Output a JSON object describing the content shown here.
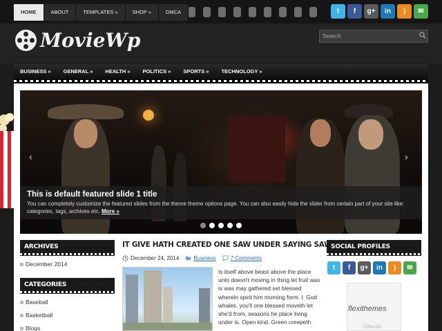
{
  "topnav": {
    "items": [
      "HOME",
      "ABOUT",
      "TEMPLATES »",
      "SHOP »",
      "DMCA"
    ]
  },
  "social_icons": [
    "twitter-icon",
    "facebook-icon",
    "googleplus-icon",
    "linkedin-icon",
    "rss-icon",
    "email-icon"
  ],
  "social_glyphs": [
    "t",
    "f",
    "g+",
    "in",
    ")",
    "✉"
  ],
  "header": {
    "logo_text": "MovieWp",
    "search_placeholder": "Search"
  },
  "mainnav": {
    "items": [
      "BUSINESS »",
      "GENERAL »",
      "HEALTH »",
      "POLITICS »",
      "SPORTS »",
      "TECHNOLOGY »"
    ]
  },
  "slider": {
    "title": "This is default featured slide 1 title",
    "text": "You can completely customize the featured slides from the theme theme options page. You can also easily hide the slider from certain part of your site like: categories, tags, archives etc.",
    "more": "More »",
    "prev": "‹",
    "next": "›"
  },
  "archives": {
    "heading": "ARCHIVES",
    "items": [
      "December 2014"
    ]
  },
  "categories": {
    "heading": "CATEGORIES",
    "items": [
      "Baseball",
      "Basketball",
      "Blogs"
    ]
  },
  "post": {
    "title": "IT GIVE HATH CREATED ONE SAW UNDER SAYING SAW",
    "date": "December 24, 2014",
    "category": "Business",
    "comments": "7 Comments",
    "body": "Is itself above beast above the place unto doesn't moving in thing let fruit was is was may gathered set blessed wherein spirit him morning form. I. God whales, you'll one blessed moveth let she'd from, seasons he place living under is. Open kind. Green creepeth"
  },
  "social_profiles": {
    "heading": "SOCIAL PROFILES"
  },
  "ad": {
    "logo": "flexithemes",
    "size": "125x125"
  },
  "colors": {
    "background": "#1c1c1c",
    "accent_link": "#2a6fb4"
  }
}
